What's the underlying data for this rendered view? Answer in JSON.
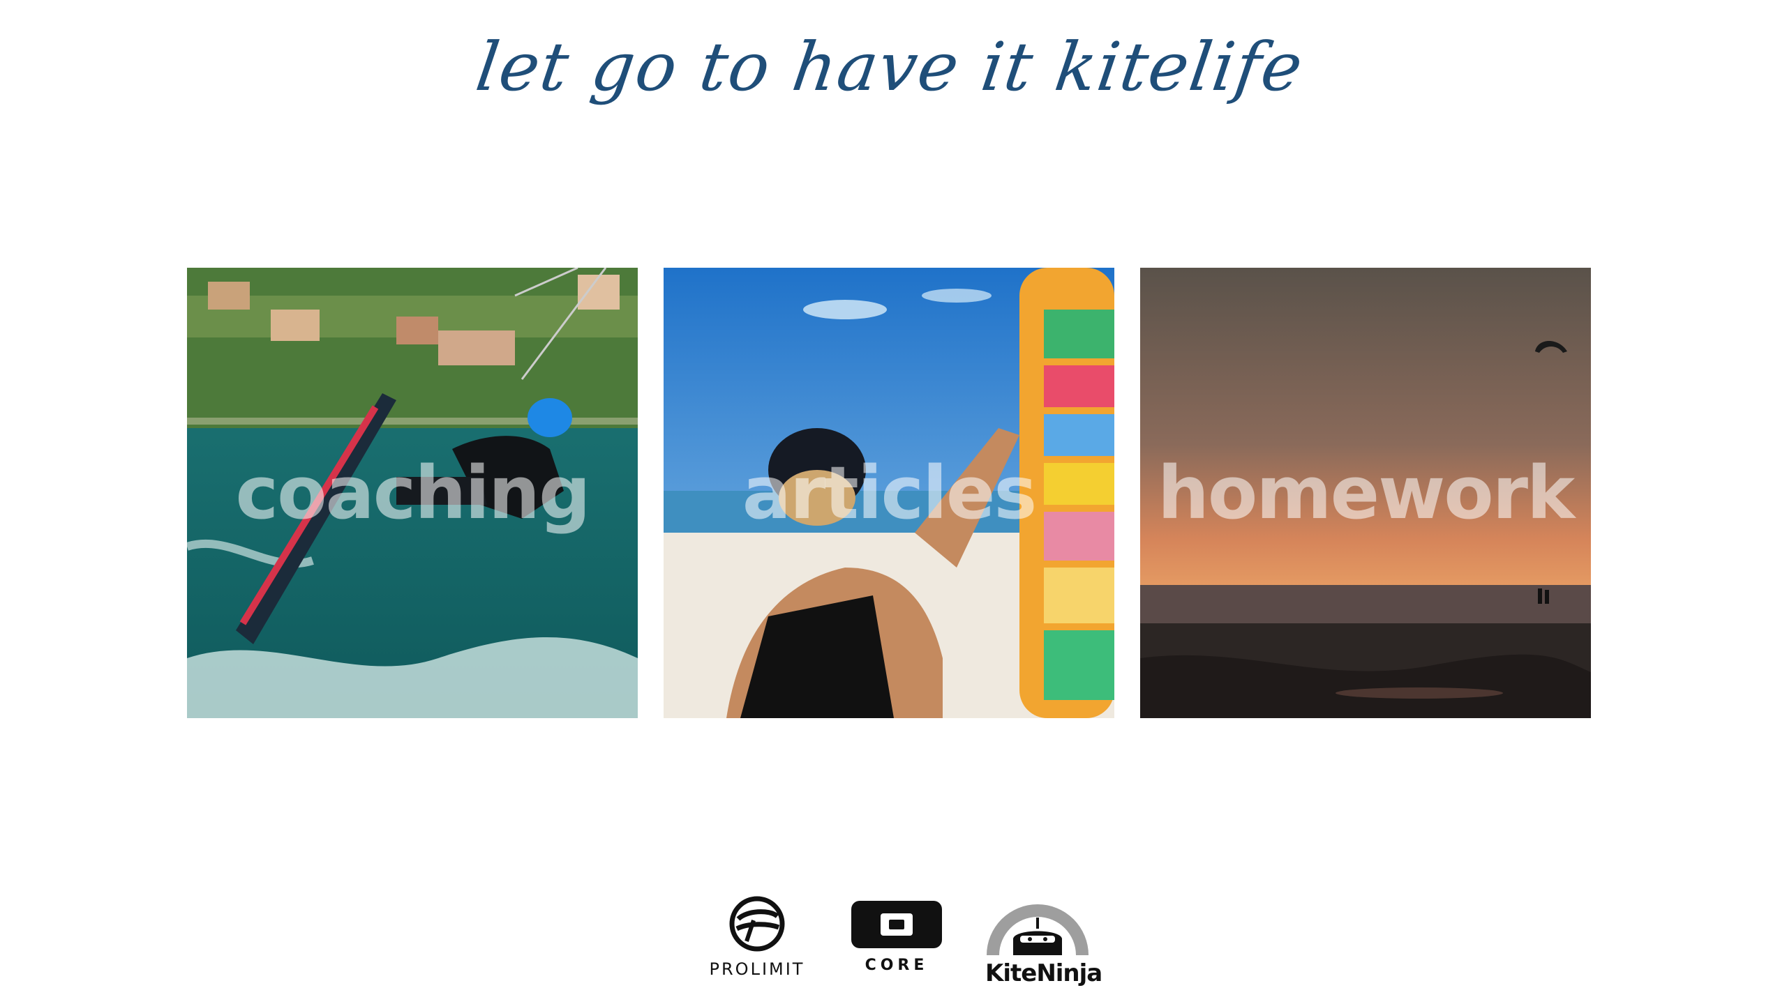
{
  "header": {
    "tagline": "let go to have it kitelife"
  },
  "tiles": [
    {
      "label": "coaching"
    },
    {
      "label": "articles"
    },
    {
      "label": "homework"
    }
  ],
  "sponsors": [
    {
      "name": "PROLIMIT"
    },
    {
      "name": "CORE"
    },
    {
      "name": "KiteNinja"
    }
  ],
  "colors": {
    "tagline": "#1f4e79",
    "label_overlay": "rgba(255,255,255,0.55)"
  }
}
